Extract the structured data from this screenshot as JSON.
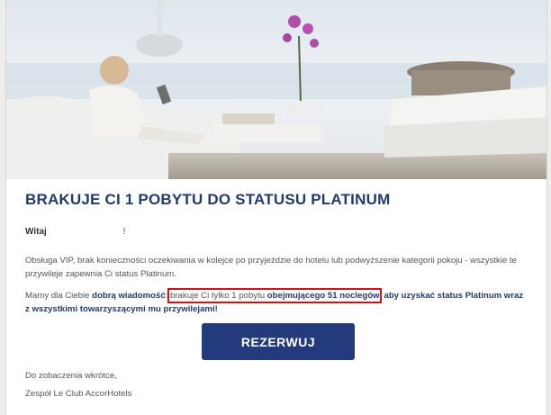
{
  "email": {
    "headline": "BRAKUJE CI 1 POBYTU DO STATUSU PLATINUM",
    "greeting": {
      "salutation": "Witaj",
      "name": "",
      "punct": "!"
    },
    "paragraph1": "Obsługa VIP, brak konieczności oczekiwania w kolejce po przyjeździe do hotelu lub podwyższenie kategorii pokoju - wszystkie te przywileje zapewnia Ci status Platinum.",
    "paragraph2": {
      "intro": "Mamy dla Ciebie ",
      "good_news": "dobrą wiadomość",
      "colon": ": ",
      "highlight_plain": "brakuje Ci tylko 1 pobytu ",
      "highlight_bold": "obejmującego 51 noclegów",
      "outro": ", aby uzyskać status Platinum wraz z wszystkimi towarzyszącymi mu przywilejami!"
    },
    "cta_label": "REZERWUJ",
    "signoff": "Do zobaczenia wkrótce,",
    "signature": "Zespół Le Club AccorHotels"
  },
  "colors": {
    "brand_navy": "#233a7c",
    "headline": "#233a6e",
    "highlight_border": "#d0121b"
  }
}
